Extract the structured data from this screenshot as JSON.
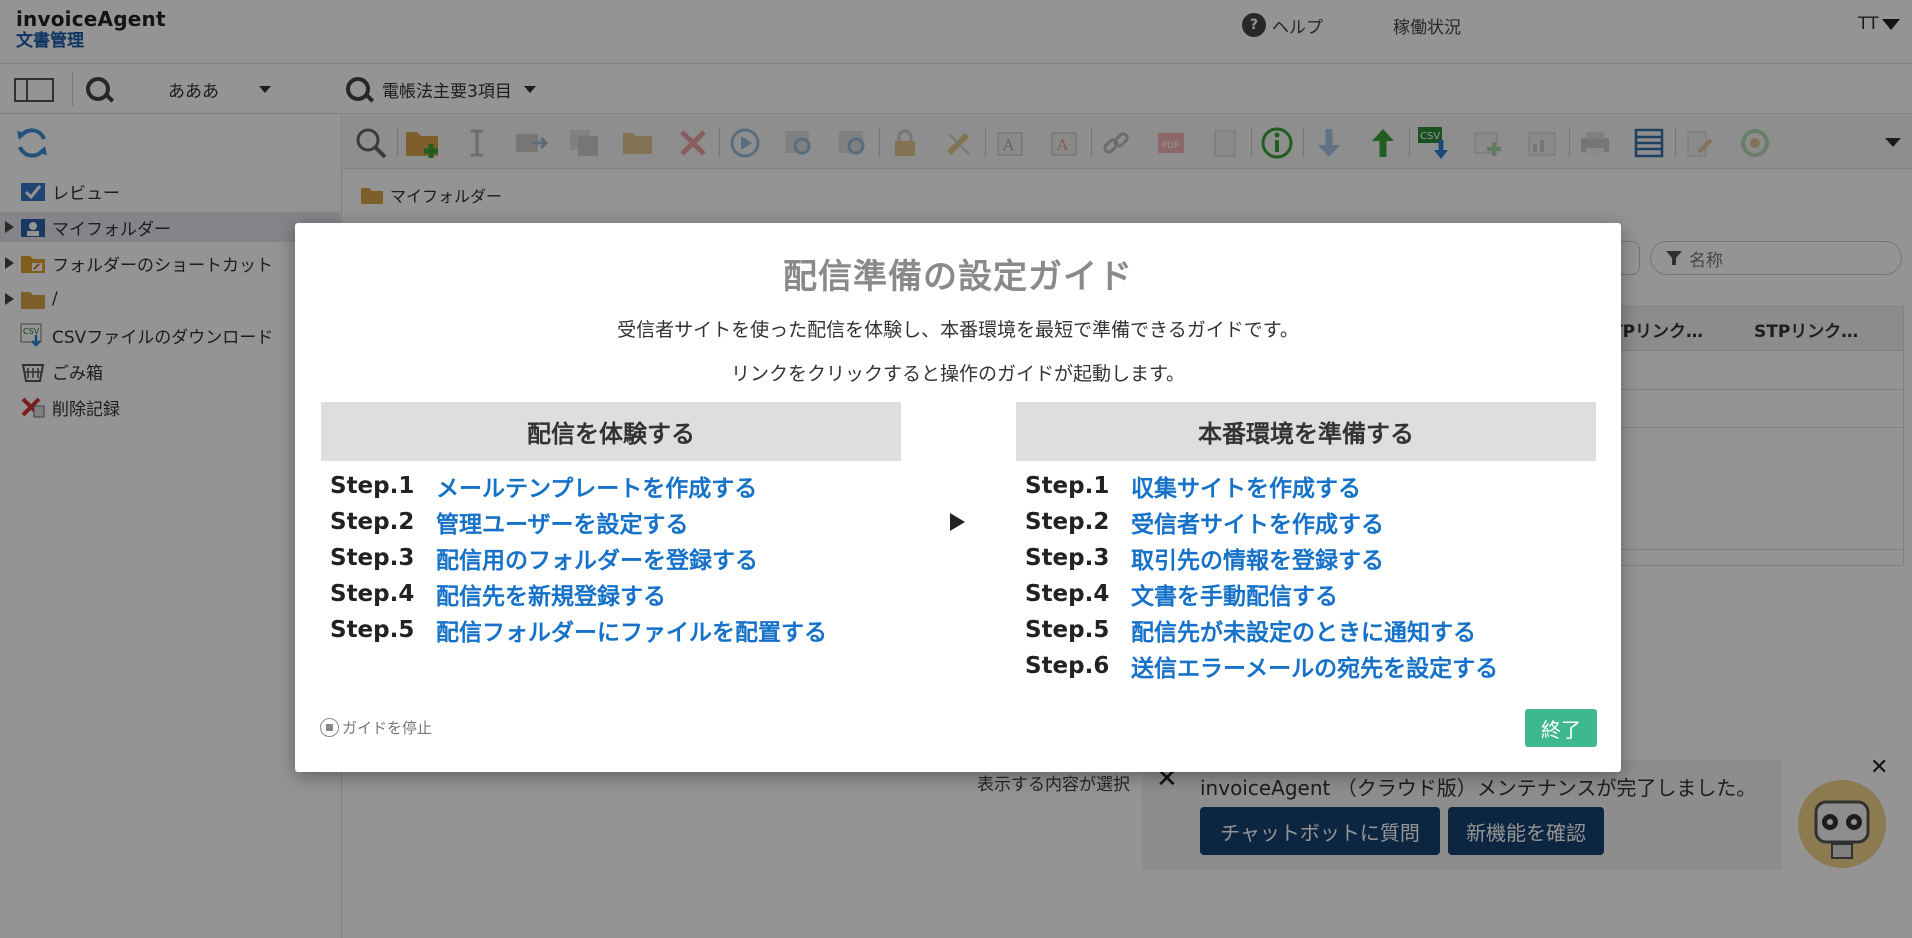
{
  "header": {
    "app_name": "invoiceAgent",
    "app_sub": "文書管理",
    "help_label": "ヘルプ",
    "status_label": "稼働状況",
    "user_initials": "TT"
  },
  "subbar": {
    "search1_value": "あああ",
    "search2_value": "電帳法主要3項目"
  },
  "sidebar": {
    "items": [
      {
        "label": "レビュー"
      },
      {
        "label": "マイフォルダー"
      },
      {
        "label": "フォルダーのショートカット"
      },
      {
        "label": "/"
      },
      {
        "label": "CSVファイルのダウンロード"
      },
      {
        "label": "ごみ箱"
      },
      {
        "label": "削除記録"
      }
    ]
  },
  "main": {
    "breadcrumb": "マイフォルダー",
    "filter_placeholder": "名称",
    "columns": [
      "TPリンク…",
      "STPリンク…"
    ],
    "notice_label": "表示する内容が選択"
  },
  "banner": {
    "message": "invoiceAgent （クラウド版）メンテナンスが完了しました。",
    "chatbot_button": "チャットボットに質問",
    "features_button": "新機能を確認"
  },
  "modal": {
    "title": "配信準備の設定ガイド",
    "desc1": "受信者サイトを使った配信を体験し、本番環境を最短で準備できるガイドです。",
    "desc2": "リンクをクリックすると操作のガイドが起動します。",
    "left": {
      "heading": "配信を体験する",
      "steps": [
        {
          "label": "Step.1",
          "link": "メールテンプレートを作成する"
        },
        {
          "label": "Step.2",
          "link": "管理ユーザーを設定する"
        },
        {
          "label": "Step.3",
          "link": "配信用のフォルダーを登録する"
        },
        {
          "label": "Step.4",
          "link": "配信先を新規登録する"
        },
        {
          "label": "Step.5",
          "link": "配信フォルダーにファイルを配置する"
        }
      ]
    },
    "right": {
      "heading": "本番環境を準備する",
      "steps": [
        {
          "label": "Step.1",
          "link": "収集サイトを作成する"
        },
        {
          "label": "Step.2",
          "link": "受信者サイトを作成する"
        },
        {
          "label": "Step.3",
          "link": "取引先の情報を登録する"
        },
        {
          "label": "Step.4",
          "link": "文書を手動配信する"
        },
        {
          "label": "Step.5",
          "link": "配信先が未設定のときに通知する"
        },
        {
          "label": "Step.6",
          "link": "送信エラーメールの宛先を設定する"
        }
      ]
    },
    "stop_guide": "ガイドを停止",
    "finish_button": "終了"
  },
  "colors": {
    "link": "#1672c9",
    "finish": "#3db88f",
    "banner_button": "#15406e",
    "brand_sub": "#1a5aa8"
  }
}
